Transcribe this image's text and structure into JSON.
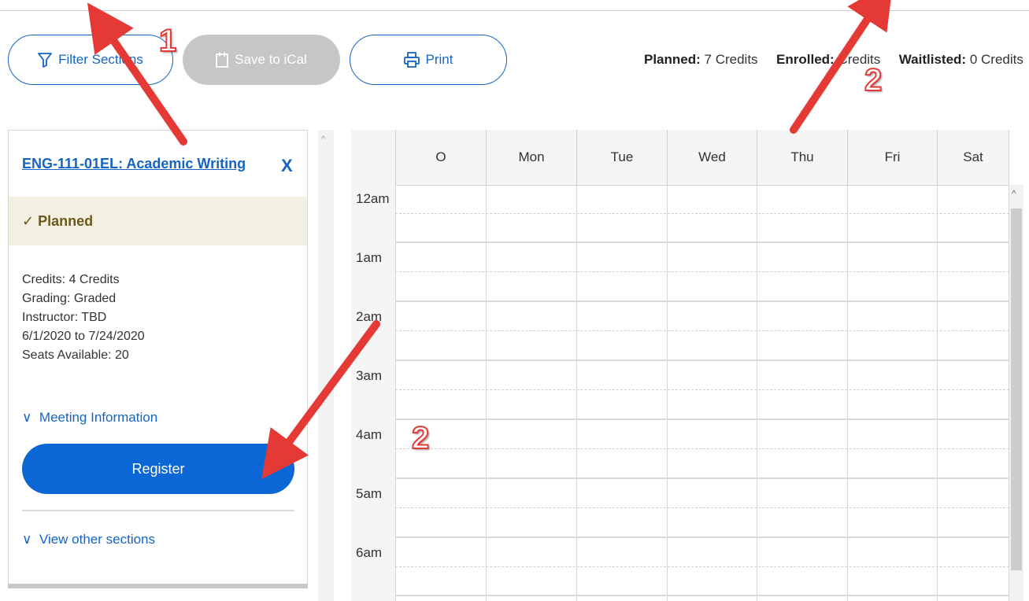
{
  "toolbar": {
    "filter_label": "Filter Sections",
    "ical_label": "Save to iCal",
    "print_label": "Print"
  },
  "credits": {
    "planned_label": "Planned:",
    "planned_value": "7 Credits",
    "enrolled_label": "Enrolled:",
    "enrolled_value": "Credits",
    "waitlisted_label": "Waitlisted:",
    "waitlisted_value": "0 Credits"
  },
  "course": {
    "title": "ENG-111-01EL: Academic Writing",
    "close": "X",
    "status": "✓ Planned",
    "details": [
      "Credits: 4 Credits",
      "Grading: Graded",
      "Instructor: TBD",
      "6/1/2020 to 7/24/2020",
      "Seats Available:  20"
    ],
    "meeting_info": "Meeting Information",
    "register_label": "Register",
    "other_sections": "View other sections"
  },
  "calendar": {
    "days": [
      "O",
      "Mon",
      "Tue",
      "Wed",
      "Thu",
      "Fri",
      "Sat"
    ],
    "hours": [
      "12am",
      "1am",
      "2am",
      "3am",
      "4am",
      "5am",
      "6am"
    ]
  },
  "annotations": [
    "1",
    "2",
    "2"
  ],
  "colors": {
    "accent": "#1565c0",
    "register": "#0b66d6",
    "planned_bg": "#f3efe1",
    "arrow": "#e53935"
  }
}
